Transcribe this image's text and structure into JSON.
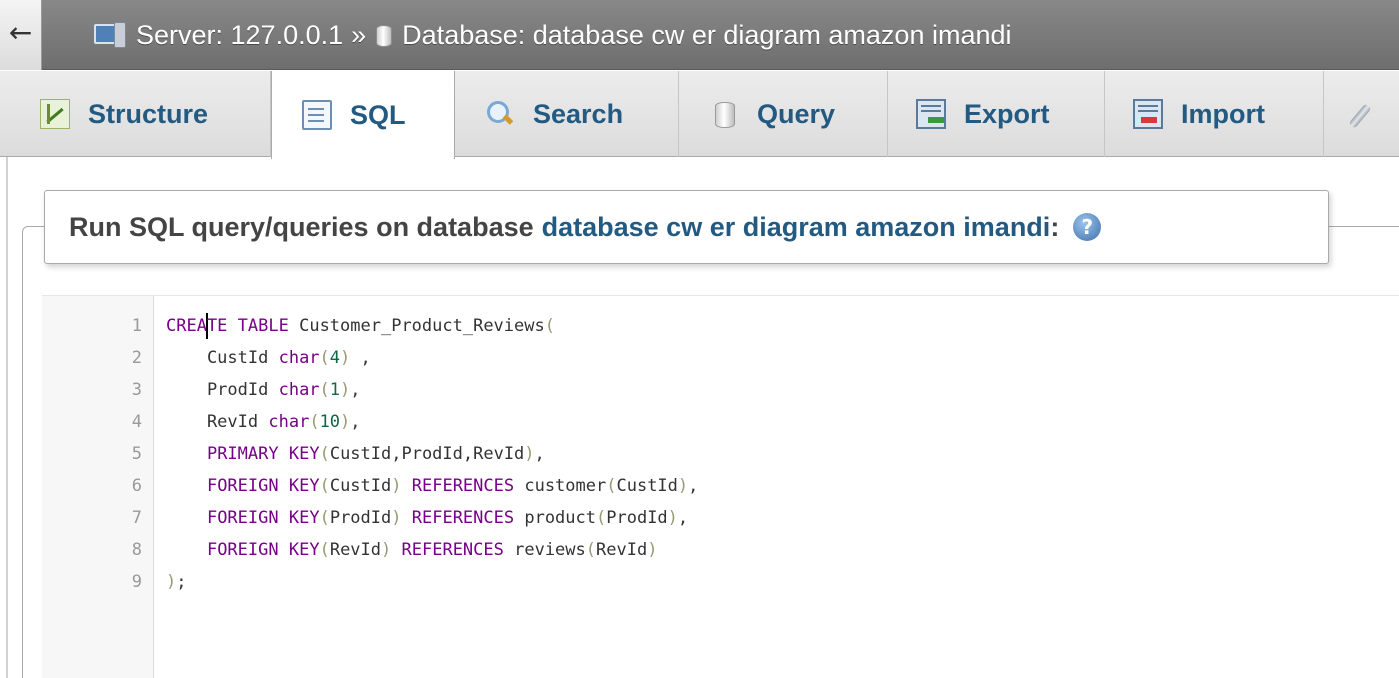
{
  "topbar": {
    "back_label": "←",
    "server_label": "Server: 127.0.0.1",
    "separator": "»",
    "database_label": "Database: database cw er diagram amazon imandi"
  },
  "tabs": [
    {
      "label": "Structure",
      "icon": "structure-icon",
      "active": false
    },
    {
      "label": "SQL",
      "icon": "sql-icon",
      "active": true
    },
    {
      "label": "Search",
      "icon": "search-icon",
      "active": false
    },
    {
      "label": "Query",
      "icon": "query-icon",
      "active": false
    },
    {
      "label": "Export",
      "icon": "export-icon",
      "active": false
    },
    {
      "label": "Import",
      "icon": "import-icon",
      "active": false
    },
    {
      "label": "",
      "icon": "wrench-icon",
      "active": false
    }
  ],
  "panel": {
    "heading_prefix": "Run SQL query/queries on database",
    "database_name": "database cw er diagram amazon imandi",
    "heading_suffix": ":",
    "help_icon": "help-icon"
  },
  "editor": {
    "lines": [
      {
        "n": "1",
        "text": "CREATE TABLE Customer_Product_Reviews("
      },
      {
        "n": "2",
        "text": "    CustId char(4) ,"
      },
      {
        "n": "3",
        "text": "    ProdId char(1),"
      },
      {
        "n": "4",
        "text": "    RevId char(10),"
      },
      {
        "n": "5",
        "text": "    PRIMARY KEY(CustId,ProdId,RevId),"
      },
      {
        "n": "6",
        "text": "    FOREIGN KEY(CustId) REFERENCES customer(CustId),"
      },
      {
        "n": "7",
        "text": "    FOREIGN KEY(ProdId) REFERENCES product(ProdId),"
      },
      {
        "n": "8",
        "text": "    FOREIGN KEY(RevId) REFERENCES reviews(RevId)"
      },
      {
        "n": "9",
        "text": ");"
      }
    ]
  },
  "colors": {
    "tab_text": "#235a81",
    "keyword": "#770088",
    "number": "#116644",
    "bracket": "#999977"
  }
}
